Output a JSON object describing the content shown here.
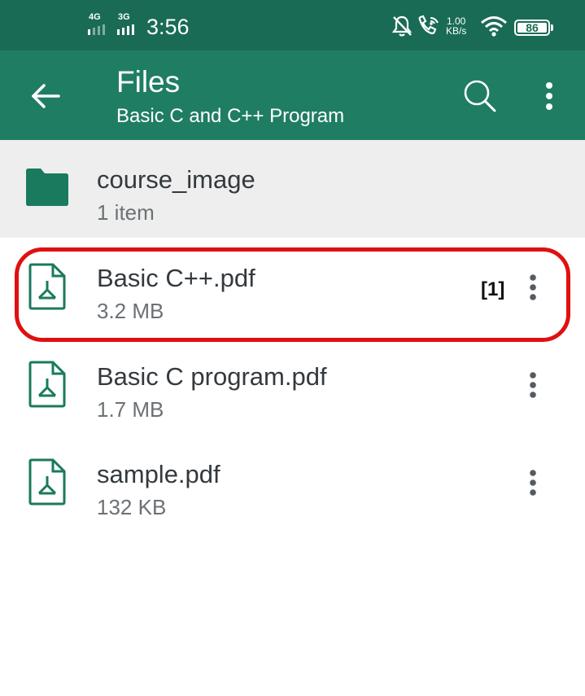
{
  "status_bar": {
    "network_1": "4G",
    "network_2": "3G",
    "time": "3:56",
    "speed_value": "1.00",
    "speed_unit": "KB/s",
    "battery": "86",
    "icons": [
      "signal-icon",
      "mute-icon",
      "wifi-call-icon",
      "wifi-icon",
      "battery-icon"
    ]
  },
  "app_bar": {
    "title": "Files",
    "subtitle": "Basic C and C++ Program",
    "back_icon": "arrow-left-icon",
    "search_icon": "search-icon",
    "more_icon": "more-vertical-icon"
  },
  "colors": {
    "status_bar": "#1a6b55",
    "app_bar": "#1f7d63",
    "accent_icon": "#1a7a5e",
    "highlight": "#e01010"
  },
  "folder": {
    "name": "course_image",
    "count": "1 item",
    "icon": "folder-icon"
  },
  "files": [
    {
      "name": "Basic C++.pdf",
      "size": "3.2 MB",
      "icon": "pdf-icon"
    },
    {
      "name": "Basic C program.pdf",
      "size": "1.7 MB",
      "icon": "pdf-icon"
    },
    {
      "name": "sample.pdf",
      "size": "132 KB",
      "icon": "pdf-icon"
    }
  ],
  "annotation": {
    "marker": "[1]"
  }
}
